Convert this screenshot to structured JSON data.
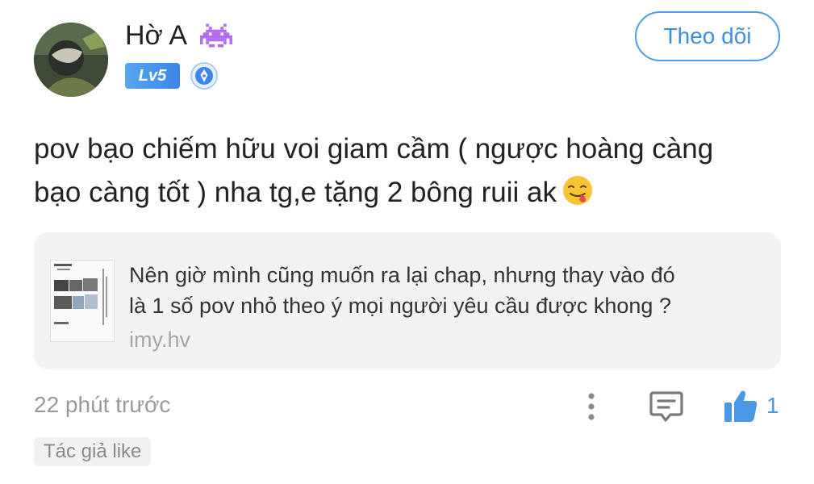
{
  "post": {
    "username": "Hờ A",
    "level": "Lv5",
    "follow_label": "Theo dõi",
    "content_line1": "pov bạo chiếm hữu voi giam cầm ( ngược hoàng càng",
    "content_line2": "bạo càng tốt ) nha tg,e tặng 2 bông ruii ak",
    "time": "22 phút trước",
    "like_count": "1",
    "author_like_label": "Tác giả like"
  },
  "link_card": {
    "text_line1": "Nên giờ mình cũng muốn ra lại chap, nhưng thay vào đó",
    "text_line2": "là 1 số pov nhỏ theo ý mọi người yêu cầu được khong ?",
    "domain": "imy.hv"
  },
  "icons": {
    "badge": "alien-monster-icon",
    "medal": "pen-medal-icon",
    "emoji": "tongue-face-emoji",
    "more": "more-vertical-icon",
    "comment": "comment-icon",
    "like": "thumbs-up-icon"
  },
  "colors": {
    "accent": "#3d8fe0",
    "muted_text": "#9a9a9a",
    "card_bg": "#f3f3f5",
    "alien": "#b16cf0"
  }
}
